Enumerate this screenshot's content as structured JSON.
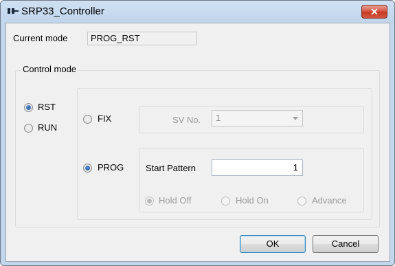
{
  "window": {
    "title": "SRP33_Controller"
  },
  "current_mode": {
    "label": "Current mode",
    "value": "PROG_RST"
  },
  "control_mode": {
    "title": "Control mode",
    "rst_label": "RST",
    "run_label": "RUN",
    "fix_label": "FIX",
    "prog_label": "PROG",
    "sv_no_label": "SV No.",
    "sv_no_value": "1",
    "start_pattern_label": "Start Pattern",
    "start_pattern_value": "1",
    "hold_off_label": "Hold Off",
    "hold_on_label": "Hold On",
    "advance_label": "Advance"
  },
  "buttons": {
    "ok": "OK",
    "cancel": "Cancel"
  },
  "icons": {
    "close": "close-icon",
    "app": "app-icon"
  },
  "colors": {
    "accent": "#1d4f94",
    "close_button": "#c23a22",
    "disabled_text": "#9a9a9a"
  }
}
